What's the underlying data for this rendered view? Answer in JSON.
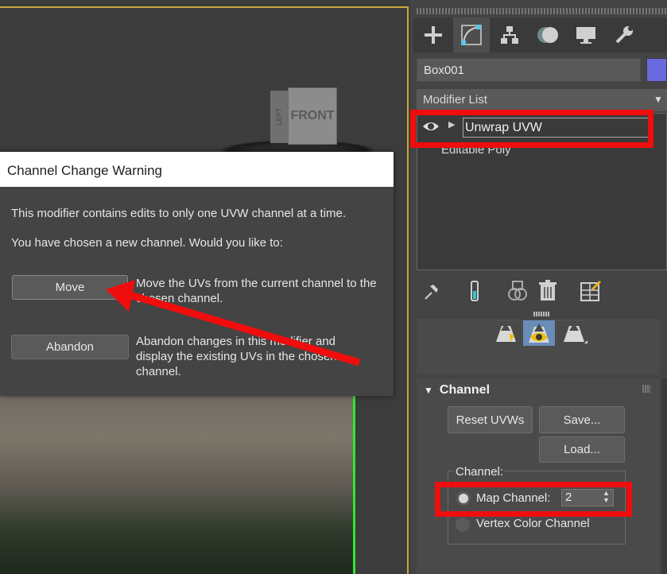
{
  "viewport": {
    "viewcube_front": "FRONT",
    "viewcube_left": "LEFT"
  },
  "dialog": {
    "title": "Channel Change Warning",
    "message1": "This modifier contains edits to only one UVW channel at a time.",
    "message2": "You have chosen a new channel. Would you like to:",
    "move_button": "Move",
    "move_desc": "Move the UVs from the current channel to the chosen channel.",
    "abandon_button": "Abandon",
    "abandon_desc": "Abandon changes in this modifier and display the existing UVs in the chosen channel."
  },
  "panel": {
    "tabs": [
      "create-icon",
      "modify-icon",
      "hierarchy-icon",
      "motion-icon",
      "display-icon",
      "utilities-icon"
    ],
    "object_name": "Box001",
    "object_color": "#6a6ae0",
    "modifier_list_label": "Modifier List",
    "stack": [
      {
        "name": "Unwrap UVW",
        "selected": true
      },
      {
        "name": "Editable Poly",
        "selected": false
      }
    ],
    "channel_rollout": {
      "title": "Channel",
      "reset_button": "Reset UVWs",
      "save_button": "Save...",
      "load_button": "Load...",
      "group_label": "Channel:",
      "map_channel_label": "Map Channel:",
      "map_channel_value": "2",
      "vertex_color_label": "Vertex Color Channel"
    }
  },
  "annotations": {
    "highlight_color": "#f00d0d"
  }
}
